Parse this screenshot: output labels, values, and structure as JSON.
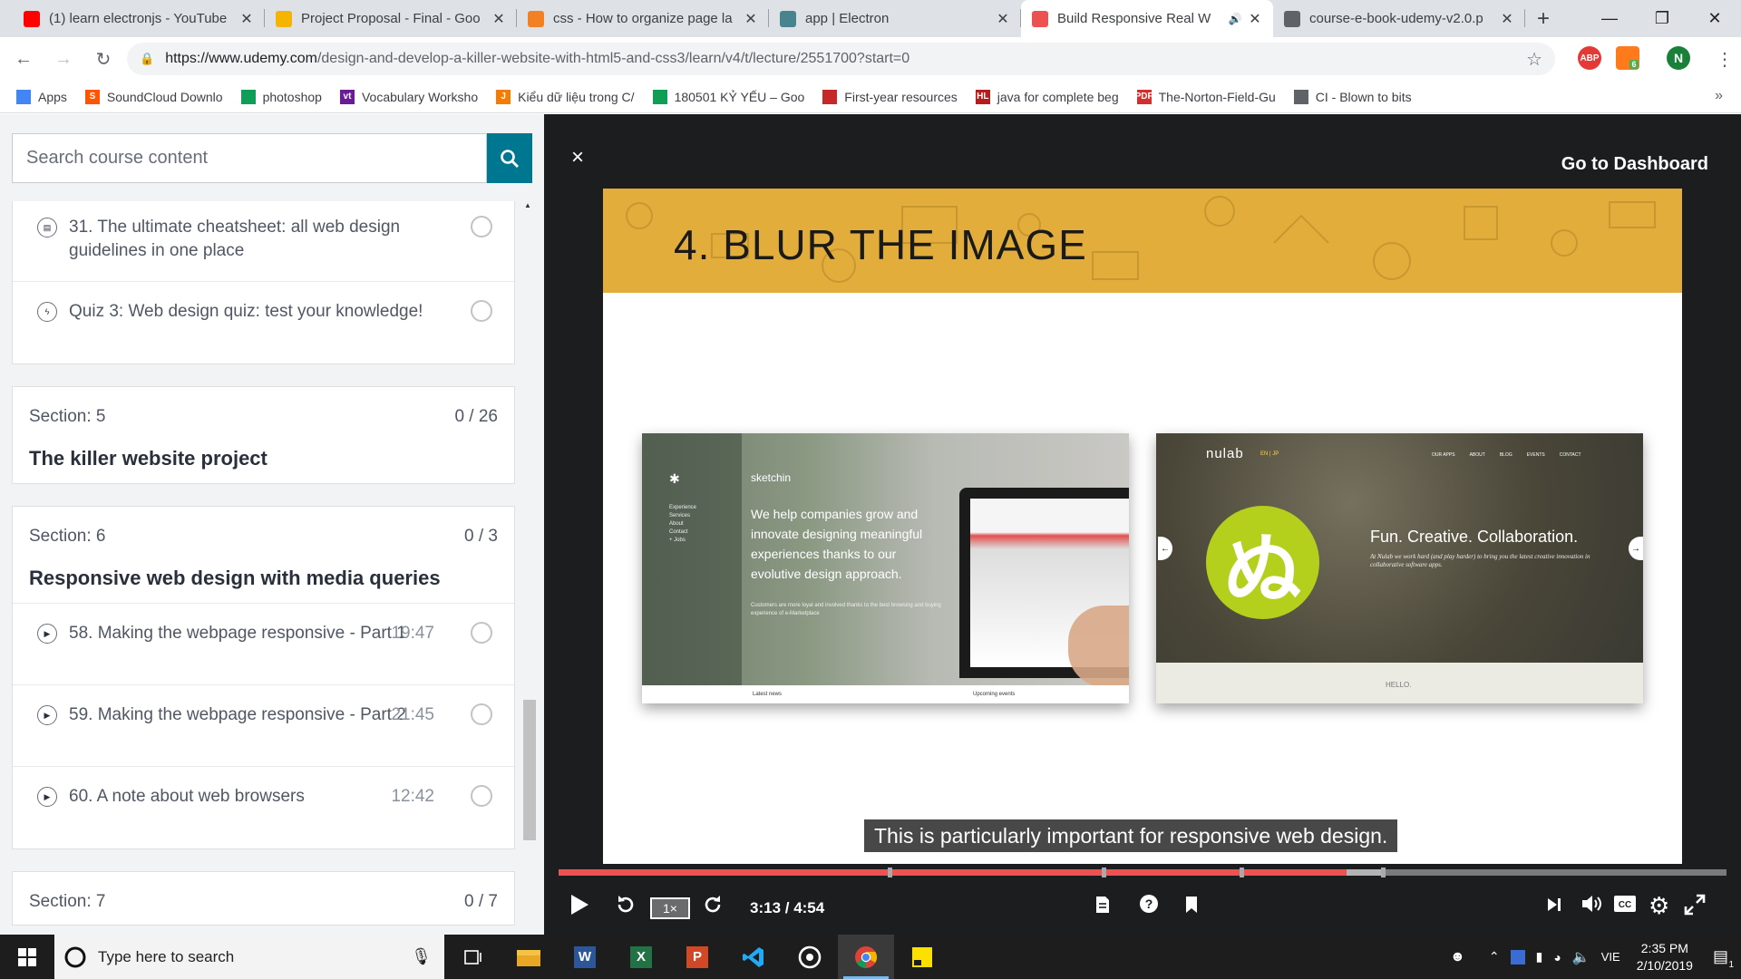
{
  "browser": {
    "tabs": [
      {
        "title": "(1) learn electronjs - YouTube",
        "icon": "youtube-icon",
        "color": "#ff0000"
      },
      {
        "title": "Project Proposal - Final - Goo",
        "icon": "google-slides-icon",
        "color": "#f4b400"
      },
      {
        "title": "css - How to organize page la",
        "icon": "stackoverflow-icon",
        "color": "#f48024"
      },
      {
        "title": "app | Electron",
        "icon": "electron-icon",
        "color": "#47848f"
      },
      {
        "title": "Build Responsive Real W",
        "icon": "udemy-icon",
        "color": "#ec5252",
        "active": true
      },
      {
        "title": "course-e-book-udemy-v2.0.p",
        "icon": "document-icon",
        "color": "#5f6368"
      }
    ],
    "url_host": "https://www.udemy.com",
    "url_path": "/design-and-develop-a-killer-website-with-html5-and-css3/learn/v4/t/lecture/2551700?start=0",
    "profile_initial": "N",
    "ext_badge": "6",
    "abp_label": "ABP",
    "bookmarks": [
      {
        "label": "Apps",
        "color": "#4285f4",
        "icon": "apps-grid-icon"
      },
      {
        "label": "SoundCloud Downlo",
        "color": "#ff5500",
        "icon": "soundcloud-icon",
        "glyph": "S"
      },
      {
        "label": "photoshop",
        "color": "#0f9d58",
        "icon": "google-drive-icon"
      },
      {
        "label": "Vocabulary Worksho",
        "color": "#6a1b9a",
        "icon": "vocabulary-icon",
        "glyph": "vt"
      },
      {
        "label": "Kiểu dữ liệu trong C/",
        "color": "#f57c00",
        "icon": "j-icon",
        "glyph": "J"
      },
      {
        "label": "180501 KỶ YẾU – Goo",
        "color": "#0f9d58",
        "icon": "google-drive-icon"
      },
      {
        "label": "First-year resources",
        "color": "#c62828",
        "icon": "resources-icon"
      },
      {
        "label": "java for complete beg",
        "color": "#b71c1c",
        "icon": "hl-icon",
        "glyph": "HL"
      },
      {
        "label": "The-Norton-Field-Gu",
        "color": "#d32f2f",
        "icon": "pdf-icon",
        "glyph": "PDF"
      },
      {
        "label": "CI - Blown to bits",
        "color": "#5f6368",
        "icon": "document-icon"
      }
    ]
  },
  "sidebar": {
    "search_placeholder": "Search course content",
    "card1_items": [
      {
        "label": "31. The ultimate cheatsheet: all web design guidelines in one place",
        "icon": "article-icon",
        "glyph": "▤"
      },
      {
        "label": "Quiz 3: Web design quiz: test your knowledge!",
        "icon": "quiz-icon",
        "glyph": "ϟ"
      }
    ],
    "section5": {
      "label": "Section: 5",
      "progress": "0 / 26",
      "title": "The killer website project"
    },
    "section6": {
      "label": "Section: 6",
      "progress": "0 / 3",
      "title": "Responsive web design with media queries",
      "items": [
        {
          "label": "58. Making the webpage responsive - Part 1",
          "duration": "19:47"
        },
        {
          "label": "59. Making the webpage responsive - Part 2",
          "duration": "21:45"
        },
        {
          "label": "60. A note about web browsers",
          "duration": "12:42"
        }
      ]
    },
    "section7": {
      "label": "Section: 7",
      "progress": "0 / 7"
    }
  },
  "player": {
    "close_label": "×",
    "dashboard_label": "Go to Dashboard",
    "slide_title": "4. BLUR THE IMAGE",
    "sketchin": {
      "brand": "sketchin",
      "nav": [
        "Experience",
        "Services",
        "About",
        "Contact",
        "+ Jobs"
      ],
      "headline": "We help companies grow and innovate designing meaningful experiences thanks to our evolutive design approach.",
      "sub": "Customers are more loyal and involved thanks to the best browsing and buying experience of e-Marketplace",
      "footer_left": "Latest news",
      "footer_right": "Upcoming events"
    },
    "nulab": {
      "brand": "nulab",
      "lang": "EN | JP",
      "nav": [
        "OUR APPS",
        "ABOUT",
        "BLOG",
        "EVENTS",
        "CONTACT"
      ],
      "logo_glyph": "ぬ",
      "headline": "Fun. Creative. Collaboration.",
      "sub": "At Nulab we work hard (and play harder) to bring you the latest creative innovation in collaborative software apps.",
      "footer": "HELLO."
    },
    "caption": "This is particularly important for responsive web design.",
    "speed": "1×",
    "time": "3:13 / 4:54",
    "progress_fraction": 0.675,
    "buffer_fraction": 0.704,
    "chapter_marks": [
      0.282,
      0.465,
      0.583,
      0.704
    ]
  },
  "taskbar": {
    "search_placeholder": "Type here to search",
    "lang": "VIE",
    "time": "2:35 PM",
    "date": "2/10/2019",
    "notif_count": "1"
  }
}
